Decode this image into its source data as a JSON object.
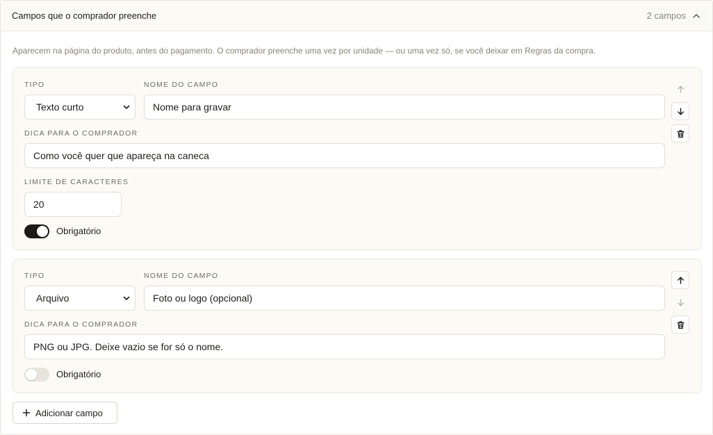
{
  "section": {
    "title": "Campos que o comprador preenche",
    "count": "2 campos",
    "description": "Aparecem na página do produto, antes do pagamento. O comprador preenche uma vez por unidade — ou uma vez só, se você deixar em Regras da compra."
  },
  "labels": {
    "type": "TIPO",
    "field_name": "NOME DO CAMPO",
    "hint": "DICA PARA O COMPRADOR",
    "char_limit": "LIMITE DE CARACTERES",
    "required": "Obrigatório"
  },
  "fields": [
    {
      "type": "Texto curto",
      "name": "Nome para gravar",
      "hint": "Como você quer que apareça na caneca",
      "char_limit": "20",
      "required": true,
      "can_move_up": false,
      "can_move_down": true
    },
    {
      "type": "Arquivo",
      "name": "Foto ou logo (opcional)",
      "hint": "PNG ou JPG. Deixe vazio se for só o nome.",
      "required": false,
      "can_move_up": true,
      "can_move_down": false
    }
  ],
  "actions": {
    "add_field": "Adicionar campo"
  },
  "icons": {
    "collapse": "chevron-up-icon",
    "select_caret": "chevron-down-icon",
    "move_up": "arrow-up-icon",
    "move_down": "arrow-down-icon",
    "delete": "trash-icon",
    "add": "plus-icon"
  },
  "colors": {
    "toggle_on": "#1c1a17",
    "toggle_off": "#e7e4db",
    "card_bg": "#fbfaf5",
    "border": "#e2dfd6"
  }
}
